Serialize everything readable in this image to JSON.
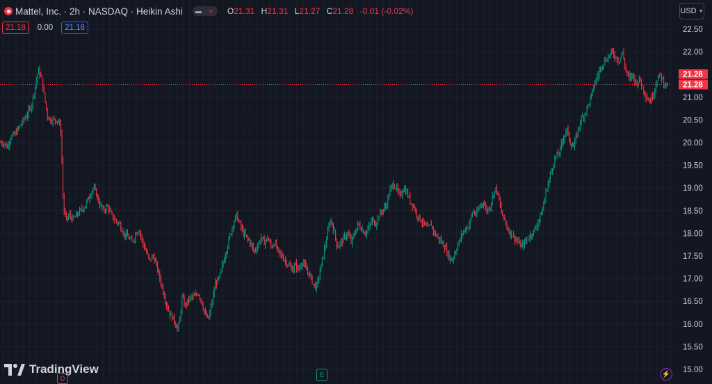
{
  "legend": {
    "symbol": "Mattel, Inc. · 2h · NASDAQ · Heikin Ashi",
    "toggle_left": "▬",
    "toggle_right": "≈",
    "open_key": "O",
    "open_val": "21.31",
    "high_key": "H",
    "high_val": "21.31",
    "low_key": "L",
    "low_val": "21.27",
    "close_key": "C",
    "close_val": "21.28",
    "change": "-0.01 (-0.02%)"
  },
  "quote": {
    "bid": "21.18",
    "spread": "0.00",
    "ask": "21.18"
  },
  "currency": "USD",
  "branding": "TradingView",
  "markers": {
    "earnings": "E",
    "dividend": "D",
    "event": "⚡"
  },
  "colors": {
    "background": "#131722",
    "up": "#089981",
    "down": "#f23645",
    "grid": "#1e222d",
    "price_line": "#f23645"
  },
  "chart_data": {
    "type": "candlestick",
    "title": "Mattel, Inc. · 2h · NASDAQ · Heikin Ashi",
    "ylim": [
      15.0,
      22.5
    ],
    "y_ticks": [
      "15.00",
      "15.50",
      "16.00",
      "16.50",
      "17.00",
      "17.50",
      "18.00",
      "18.50",
      "19.00",
      "19.50",
      "20.00",
      "20.50",
      "21.00",
      "21.50",
      "22.00",
      "22.50"
    ],
    "last_price_labels": [
      "21.28",
      "21.28"
    ],
    "last_price": 21.28,
    "grid": true,
    "path": [
      [
        0,
        20.0
      ],
      [
        5,
        20.0
      ],
      [
        10,
        19.9
      ],
      [
        15,
        20.1
      ],
      [
        22,
        20.2
      ],
      [
        30,
        20.4
      ],
      [
        38,
        20.6
      ],
      [
        45,
        20.8
      ],
      [
        50,
        21.2
      ],
      [
        55,
        21.6
      ],
      [
        60,
        21.4
      ],
      [
        64,
        21.0
      ],
      [
        68,
        20.6
      ],
      [
        72,
        20.5
      ],
      [
        78,
        20.5
      ],
      [
        84,
        20.5
      ],
      [
        88,
        20.2
      ],
      [
        90,
        19.0
      ],
      [
        92,
        18.5
      ],
      [
        95,
        18.3
      ],
      [
        100,
        18.4
      ],
      [
        105,
        18.3
      ],
      [
        110,
        18.4
      ],
      [
        116,
        18.5
      ],
      [
        122,
        18.6
      ],
      [
        128,
        18.8
      ],
      [
        134,
        19.0
      ],
      [
        138,
        18.9
      ],
      [
        142,
        18.7
      ],
      [
        148,
        18.5
      ],
      [
        155,
        18.6
      ],
      [
        160,
        18.4
      ],
      [
        165,
        18.3
      ],
      [
        172,
        18.2
      ],
      [
        178,
        18.0
      ],
      [
        185,
        17.9
      ],
      [
        190,
        17.8
      ],
      [
        195,
        18.0
      ],
      [
        200,
        18.1
      ],
      [
        205,
        17.8
      ],
      [
        210,
        17.6
      ],
      [
        215,
        17.4
      ],
      [
        220,
        17.5
      ],
      [
        225,
        17.3
      ],
      [
        230,
        17.0
      ],
      [
        235,
        16.7
      ],
      [
        240,
        16.4
      ],
      [
        245,
        16.2
      ],
      [
        250,
        16.1
      ],
      [
        255,
        15.9
      ],
      [
        258,
        16.0
      ],
      [
        262,
        16.6
      ],
      [
        266,
        16.4
      ],
      [
        270,
        16.5
      ],
      [
        275,
        16.6
      ],
      [
        280,
        16.6
      ],
      [
        285,
        16.7
      ],
      [
        290,
        16.5
      ],
      [
        295,
        16.2
      ],
      [
        300,
        16.1
      ],
      [
        305,
        16.5
      ],
      [
        310,
        16.9
      ],
      [
        315,
        17.0
      ],
      [
        320,
        17.3
      ],
      [
        325,
        17.6
      ],
      [
        330,
        17.9
      ],
      [
        335,
        18.2
      ],
      [
        340,
        18.4
      ],
      [
        345,
        18.2
      ],
      [
        350,
        18.0
      ],
      [
        355,
        17.9
      ],
      [
        360,
        17.8
      ],
      [
        365,
        17.6
      ],
      [
        370,
        17.7
      ],
      [
        375,
        17.9
      ],
      [
        380,
        17.8
      ],
      [
        385,
        17.9
      ],
      [
        390,
        17.7
      ],
      [
        395,
        17.8
      ],
      [
        400,
        17.6
      ],
      [
        405,
        17.5
      ],
      [
        410,
        17.4
      ],
      [
        415,
        17.3
      ],
      [
        420,
        17.2
      ],
      [
        425,
        17.3
      ],
      [
        430,
        17.2
      ],
      [
        435,
        17.4
      ],
      [
        440,
        17.2
      ],
      [
        445,
        17.1
      ],
      [
        450,
        16.9
      ],
      [
        455,
        16.8
      ],
      [
        458,
        17.0
      ],
      [
        462,
        17.3
      ],
      [
        466,
        17.6
      ],
      [
        470,
        17.9
      ],
      [
        475,
        18.3
      ],
      [
        480,
        18.1
      ],
      [
        485,
        17.7
      ],
      [
        490,
        17.8
      ],
      [
        495,
        17.9
      ],
      [
        500,
        18.0
      ],
      [
        505,
        17.8
      ],
      [
        510,
        18.0
      ],
      [
        515,
        18.2
      ],
      [
        520,
        18.1
      ],
      [
        525,
        18.0
      ],
      [
        530,
        18.1
      ],
      [
        535,
        18.3
      ],
      [
        540,
        18.2
      ],
      [
        545,
        18.4
      ],
      [
        550,
        18.5
      ],
      [
        555,
        18.6
      ],
      [
        560,
        18.9
      ],
      [
        565,
        19.1
      ],
      [
        570,
        19.0
      ],
      [
        575,
        18.8
      ],
      [
        580,
        19.0
      ],
      [
        585,
        18.9
      ],
      [
        590,
        18.7
      ],
      [
        595,
        18.6
      ],
      [
        600,
        18.4
      ],
      [
        605,
        18.3
      ],
      [
        610,
        18.2
      ],
      [
        615,
        18.1
      ],
      [
        620,
        18.2
      ],
      [
        625,
        18.0
      ],
      [
        630,
        17.9
      ],
      [
        635,
        17.8
      ],
      [
        640,
        17.7
      ],
      [
        645,
        17.5
      ],
      [
        650,
        17.4
      ],
      [
        655,
        17.6
      ],
      [
        660,
        17.8
      ],
      [
        665,
        18.0
      ],
      [
        670,
        18.1
      ],
      [
        675,
        18.2
      ],
      [
        680,
        18.5
      ],
      [
        685,
        18.4
      ],
      [
        690,
        18.6
      ],
      [
        695,
        18.7
      ],
      [
        700,
        18.5
      ],
      [
        705,
        18.6
      ],
      [
        710,
        18.9
      ],
      [
        714,
        19.0
      ],
      [
        718,
        18.7
      ],
      [
        722,
        18.4
      ],
      [
        726,
        18.3
      ],
      [
        730,
        18.1
      ],
      [
        735,
        18.0
      ],
      [
        740,
        17.9
      ],
      [
        745,
        17.8
      ],
      [
        750,
        17.7
      ],
      [
        755,
        17.8
      ],
      [
        760,
        17.9
      ],
      [
        765,
        18.0
      ],
      [
        770,
        18.1
      ],
      [
        775,
        18.3
      ],
      [
        780,
        18.5
      ],
      [
        785,
        18.9
      ],
      [
        790,
        19.2
      ],
      [
        795,
        19.5
      ],
      [
        800,
        19.7
      ],
      [
        805,
        19.8
      ],
      [
        810,
        20.1
      ],
      [
        815,
        20.3
      ],
      [
        820,
        20.0
      ],
      [
        825,
        19.9
      ],
      [
        830,
        20.2
      ],
      [
        835,
        20.5
      ],
      [
        840,
        20.6
      ],
      [
        845,
        20.8
      ],
      [
        850,
        21.0
      ],
      [
        855,
        21.3
      ],
      [
        860,
        21.5
      ],
      [
        865,
        21.7
      ],
      [
        870,
        21.8
      ],
      [
        875,
        21.9
      ],
      [
        880,
        22.0
      ],
      [
        885,
        21.9
      ],
      [
        890,
        21.8
      ],
      [
        895,
        22.0
      ],
      [
        900,
        21.6
      ],
      [
        905,
        21.4
      ],
      [
        910,
        21.5
      ],
      [
        915,
        21.3
      ],
      [
        920,
        21.4
      ],
      [
        925,
        21.2
      ],
      [
        930,
        21.0
      ],
      [
        935,
        20.9
      ],
      [
        940,
        21.1
      ],
      [
        945,
        21.4
      ],
      [
        950,
        21.5
      ],
      [
        955,
        21.3
      ],
      [
        960,
        21.28
      ]
    ]
  }
}
